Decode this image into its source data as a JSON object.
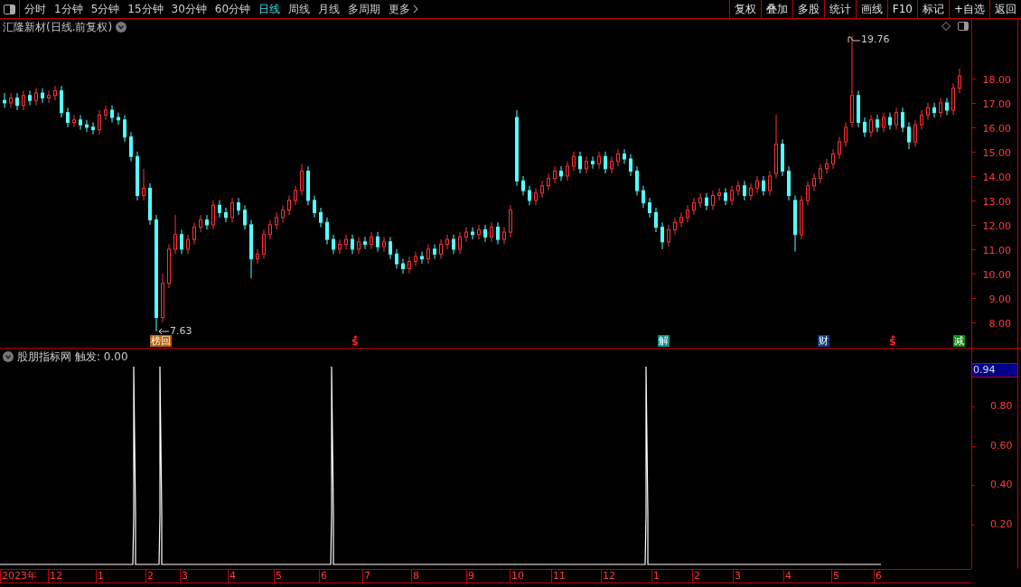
{
  "toolbar": {
    "periods": [
      {
        "label": "分时",
        "selected": false
      },
      {
        "label": "1分钟",
        "selected": false
      },
      {
        "label": "5分钟",
        "selected": false
      },
      {
        "label": "15分钟",
        "selected": false
      },
      {
        "label": "30分钟",
        "selected": false
      },
      {
        "label": "60分钟",
        "selected": false
      },
      {
        "label": "日线",
        "selected": true
      },
      {
        "label": "周线",
        "selected": false
      },
      {
        "label": "月线",
        "selected": false
      },
      {
        "label": "多周期",
        "selected": false
      }
    ],
    "more": "更多",
    "buttons": [
      "复权",
      "叠加",
      "多股",
      "统计",
      "画线",
      "F10",
      "标记",
      "+自选",
      "返回"
    ]
  },
  "main_chart": {
    "title": "汇隆新材(日线.前复权)",
    "high_label": "19.76",
    "low_label": "7.63",
    "chart_data": {
      "type": "candlestick",
      "ylim": [
        6.96,
        20.44
      ],
      "yticks": [
        {
          "value": 18,
          "label": "18.00"
        },
        {
          "value": 17,
          "label": "17.00"
        },
        {
          "value": 16,
          "label": "16.00"
        },
        {
          "value": 15,
          "label": "15.00"
        },
        {
          "value": 14,
          "label": "14.00"
        },
        {
          "value": 13,
          "label": "13.00"
        },
        {
          "value": 12,
          "label": "12.00"
        },
        {
          "value": 11,
          "label": "11.00"
        },
        {
          "value": 10,
          "label": "10.00"
        },
        {
          "value": 9,
          "label": "9.00"
        },
        {
          "value": 8,
          "label": "8.00"
        }
      ],
      "ohlc": [
        [
          17.1,
          17.4,
          16.8,
          17.0
        ],
        [
          17.0,
          17.4,
          16.8,
          17.2
        ],
        [
          17.2,
          17.4,
          16.7,
          16.9
        ],
        [
          16.9,
          17.5,
          16.7,
          17.3
        ],
        [
          17.3,
          17.5,
          16.9,
          17.1
        ],
        [
          17.1,
          17.6,
          16.9,
          17.4
        ],
        [
          17.4,
          17.6,
          17.0,
          17.2
        ],
        [
          17.2,
          17.5,
          17.0,
          17.3
        ],
        [
          17.3,
          17.7,
          17.1,
          17.5
        ],
        [
          17.5,
          17.7,
          16.4,
          16.6
        ],
        [
          16.6,
          16.8,
          16.0,
          16.2
        ],
        [
          16.2,
          16.5,
          16.0,
          16.3
        ],
        [
          16.3,
          16.5,
          15.9,
          16.1
        ],
        [
          16.1,
          16.3,
          15.8,
          16.0
        ],
        [
          16.0,
          16.2,
          15.7,
          15.9
        ],
        [
          15.9,
          16.7,
          15.7,
          16.5
        ],
        [
          16.5,
          16.9,
          16.3,
          16.7
        ],
        [
          16.7,
          16.9,
          16.2,
          16.4
        ],
        [
          16.4,
          16.6,
          16.1,
          16.3
        ],
        [
          16.3,
          16.5,
          15.4,
          15.6
        ],
        [
          15.6,
          15.8,
          14.6,
          14.8
        ],
        [
          14.8,
          15.0,
          13.0,
          13.2
        ],
        [
          13.2,
          14.3,
          13.0,
          13.5
        ],
        [
          13.5,
          13.7,
          12.0,
          12.2
        ],
        [
          12.2,
          12.4,
          7.63,
          8.2
        ],
        [
          8.2,
          10.0,
          8.0,
          9.6
        ],
        [
          9.6,
          11.2,
          9.4,
          11.0
        ],
        [
          11.0,
          12.4,
          10.8,
          11.6
        ],
        [
          11.6,
          11.8,
          10.8,
          11.0
        ],
        [
          11.0,
          11.6,
          10.8,
          11.4
        ],
        [
          11.4,
          12.1,
          11.2,
          11.9
        ],
        [
          11.9,
          12.4,
          11.7,
          12.2
        ],
        [
          12.2,
          12.4,
          11.8,
          12.0
        ],
        [
          12.0,
          13.0,
          11.8,
          12.8
        ],
        [
          12.8,
          13.0,
          12.3,
          12.5
        ],
        [
          12.5,
          12.7,
          12.1,
          12.3
        ],
        [
          12.3,
          13.1,
          12.1,
          12.9
        ],
        [
          12.9,
          13.1,
          12.4,
          12.6
        ],
        [
          12.6,
          12.8,
          11.8,
          12.0
        ],
        [
          12.0,
          12.2,
          9.8,
          10.6
        ],
        [
          10.6,
          11.0,
          10.4,
          10.8
        ],
        [
          10.8,
          11.8,
          10.6,
          11.6
        ],
        [
          11.6,
          12.2,
          11.4,
          12.0
        ],
        [
          12.0,
          12.5,
          11.8,
          12.3
        ],
        [
          12.3,
          12.8,
          12.1,
          12.6
        ],
        [
          12.6,
          13.2,
          12.4,
          13.0
        ],
        [
          13.0,
          13.6,
          12.8,
          13.4
        ],
        [
          13.4,
          14.5,
          13.2,
          14.2
        ],
        [
          14.2,
          14.4,
          12.8,
          13.0
        ],
        [
          13.0,
          13.2,
          12.3,
          12.5
        ],
        [
          12.5,
          12.7,
          11.9,
          12.1
        ],
        [
          12.1,
          12.3,
          11.2,
          11.4
        ],
        [
          11.4,
          11.6,
          10.8,
          11.0
        ],
        [
          11.0,
          11.4,
          10.8,
          11.2
        ],
        [
          11.2,
          11.6,
          11.0,
          11.4
        ],
        [
          11.4,
          11.6,
          10.8,
          11.0
        ],
        [
          11.0,
          11.5,
          10.8,
          11.3
        ],
        [
          11.3,
          11.5,
          11.0,
          11.2
        ],
        [
          11.2,
          11.7,
          11.0,
          11.5
        ],
        [
          11.5,
          11.7,
          10.9,
          11.1
        ],
        [
          11.1,
          11.5,
          10.9,
          11.3
        ],
        [
          11.3,
          11.5,
          10.6,
          10.8
        ],
        [
          10.8,
          11.0,
          10.2,
          10.4
        ],
        [
          10.4,
          10.6,
          10.0,
          10.2
        ],
        [
          10.2,
          10.7,
          10.0,
          10.5
        ],
        [
          10.5,
          10.9,
          10.3,
          10.7
        ],
        [
          10.7,
          10.9,
          10.4,
          10.6
        ],
        [
          10.6,
          11.2,
          10.4,
          11.0
        ],
        [
          11.0,
          11.2,
          10.6,
          10.8
        ],
        [
          10.8,
          11.4,
          10.6,
          11.2
        ],
        [
          11.2,
          11.6,
          11.0,
          11.4
        ],
        [
          11.4,
          11.6,
          10.8,
          11.0
        ],
        [
          11.0,
          11.7,
          10.8,
          11.5
        ],
        [
          11.5,
          11.9,
          11.3,
          11.7
        ],
        [
          11.7,
          11.9,
          11.4,
          11.6
        ],
        [
          11.6,
          12.0,
          11.4,
          11.8
        ],
        [
          11.8,
          12.0,
          11.3,
          11.5
        ],
        [
          11.5,
          12.1,
          11.3,
          11.9
        ],
        [
          11.9,
          12.1,
          11.2,
          11.4
        ],
        [
          11.4,
          11.9,
          11.2,
          11.7
        ],
        [
          11.7,
          12.8,
          11.5,
          12.6
        ],
        [
          16.4,
          16.7,
          13.6,
          13.8
        ],
        [
          13.8,
          14.0,
          13.2,
          13.4
        ],
        [
          13.4,
          13.6,
          12.8,
          13.0
        ],
        [
          13.0,
          13.5,
          12.8,
          13.3
        ],
        [
          13.3,
          13.8,
          13.1,
          13.6
        ],
        [
          13.6,
          14.1,
          13.4,
          13.9
        ],
        [
          13.9,
          14.4,
          13.7,
          14.2
        ],
        [
          14.2,
          14.4,
          13.8,
          14.0
        ],
        [
          14.0,
          14.6,
          13.8,
          14.4
        ],
        [
          14.4,
          15.0,
          14.2,
          14.8
        ],
        [
          14.8,
          15.0,
          14.1,
          14.3
        ],
        [
          14.3,
          14.8,
          14.1,
          14.6
        ],
        [
          14.6,
          14.8,
          14.3,
          14.5
        ],
        [
          14.5,
          15.0,
          14.3,
          14.8
        ],
        [
          14.8,
          15.0,
          14.1,
          14.3
        ],
        [
          14.3,
          14.8,
          14.1,
          14.6
        ],
        [
          14.6,
          15.1,
          14.4,
          14.9
        ],
        [
          14.9,
          15.1,
          14.5,
          14.7
        ],
        [
          14.7,
          14.9,
          14.0,
          14.2
        ],
        [
          14.2,
          14.4,
          13.2,
          13.4
        ],
        [
          13.4,
          13.6,
          12.7,
          12.9
        ],
        [
          12.9,
          13.1,
          12.3,
          12.5
        ],
        [
          12.5,
          12.7,
          11.7,
          11.9
        ],
        [
          11.9,
          12.1,
          11.0,
          11.3
        ],
        [
          11.3,
          12.0,
          11.1,
          11.8
        ],
        [
          11.8,
          12.3,
          11.6,
          12.1
        ],
        [
          12.1,
          12.5,
          11.9,
          12.3
        ],
        [
          12.3,
          12.8,
          12.1,
          12.6
        ],
        [
          12.6,
          13.1,
          12.4,
          12.9
        ],
        [
          12.9,
          13.3,
          12.7,
          13.1
        ],
        [
          13.1,
          13.3,
          12.6,
          12.8
        ],
        [
          12.8,
          13.4,
          12.6,
          13.2
        ],
        [
          13.2,
          13.5,
          13.0,
          13.3
        ],
        [
          13.3,
          13.5,
          12.8,
          13.0
        ],
        [
          13.0,
          13.6,
          12.8,
          13.4
        ],
        [
          13.4,
          13.8,
          13.2,
          13.6
        ],
        [
          13.6,
          13.8,
          13.0,
          13.2
        ],
        [
          13.2,
          13.7,
          13.0,
          13.5
        ],
        [
          13.5,
          14.0,
          13.3,
          13.8
        ],
        [
          13.8,
          14.0,
          13.2,
          13.4
        ],
        [
          13.4,
          14.2,
          13.2,
          14.0
        ],
        [
          14.1,
          16.5,
          13.9,
          15.3
        ],
        [
          15.3,
          15.5,
          14.0,
          14.2
        ],
        [
          14.2,
          14.4,
          13.0,
          13.2
        ],
        [
          13.0,
          13.2,
          10.9,
          11.6
        ],
        [
          11.6,
          13.2,
          11.4,
          13.0
        ],
        [
          13.0,
          13.8,
          12.8,
          13.6
        ],
        [
          13.6,
          14.1,
          13.4,
          13.9
        ],
        [
          13.9,
          14.5,
          13.7,
          14.3
        ],
        [
          14.3,
          14.7,
          14.1,
          14.5
        ],
        [
          14.5,
          15.1,
          14.3,
          14.9
        ],
        [
          14.9,
          15.6,
          14.7,
          15.4
        ],
        [
          15.4,
          16.2,
          15.2,
          16.0
        ],
        [
          16.2,
          19.76,
          16.0,
          17.3
        ],
        [
          17.3,
          17.5,
          16.0,
          16.2
        ],
        [
          16.2,
          16.4,
          15.6,
          15.8
        ],
        [
          15.8,
          16.5,
          15.6,
          16.3
        ],
        [
          16.3,
          16.5,
          15.8,
          16.0
        ],
        [
          16.0,
          16.6,
          15.8,
          16.4
        ],
        [
          16.4,
          16.6,
          15.9,
          16.1
        ],
        [
          16.1,
          16.8,
          15.9,
          16.6
        ],
        [
          16.6,
          16.8,
          15.8,
          16.0
        ],
        [
          16.0,
          16.2,
          15.1,
          15.4
        ],
        [
          15.4,
          16.3,
          15.2,
          16.1
        ],
        [
          16.1,
          16.7,
          15.9,
          16.5
        ],
        [
          16.5,
          17.0,
          16.3,
          16.8
        ],
        [
          16.8,
          17.0,
          16.4,
          16.6
        ],
        [
          16.6,
          17.2,
          16.4,
          17.0
        ],
        [
          17.0,
          17.2,
          16.5,
          16.7
        ],
        [
          16.7,
          17.8,
          16.5,
          17.6
        ],
        [
          17.6,
          18.4,
          17.4,
          18.1
        ]
      ]
    },
    "event_markers": [
      {
        "kind": "badge",
        "text": "榜回",
        "color": "#b5620f"
      },
      {
        "kind": "dollar",
        "text": "$",
        "color": "#ff2020"
      },
      {
        "kind": "badge",
        "text": "解",
        "color": "#0f8a8a"
      },
      {
        "kind": "badge",
        "text": "财",
        "color": "#123a7a"
      },
      {
        "kind": "dollar",
        "text": "$",
        "color": "#ff2020"
      },
      {
        "kind": "badge",
        "text": "减",
        "color": "#138a13"
      }
    ]
  },
  "indicator_panel": {
    "name": "股朋指标网",
    "reading": "触发: 0.00",
    "current_value": "0.94",
    "axis": [
      "0.80",
      "0.60",
      "0.40",
      "0.20"
    ]
  },
  "date_axis": [
    "2023年",
    "12",
    "1",
    "2",
    "3",
    "4",
    "5",
    "6",
    "7",
    "8",
    "9",
    "10",
    "11",
    "12",
    "1",
    "2",
    "3",
    "4",
    "5",
    "6"
  ]
}
